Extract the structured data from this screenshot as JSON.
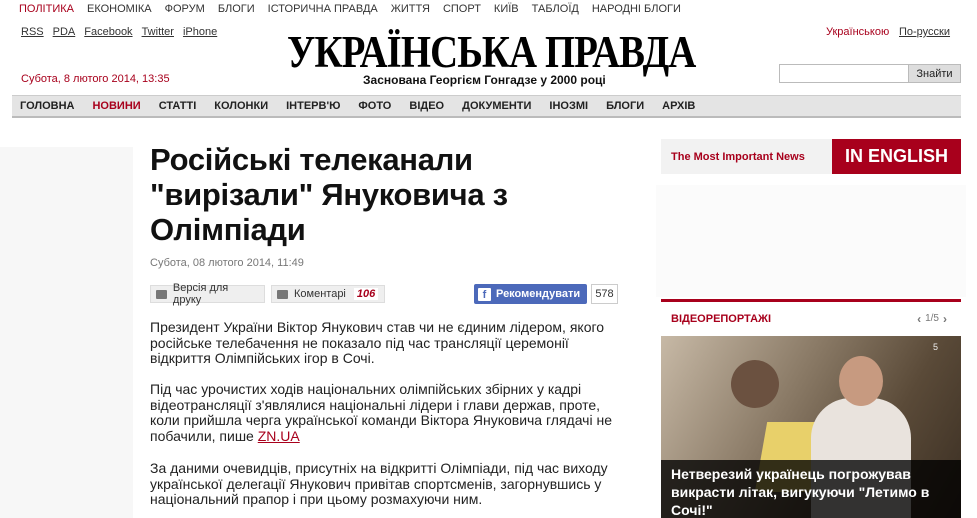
{
  "top_nav": [
    "ПОЛІТИКА",
    "ЕКОНОМІКА",
    "ФОРУМ",
    "БЛОГИ",
    "ІСТОРИЧНА ПРАВДА",
    "ЖИТТЯ",
    "СПОРТ",
    "КИЇВ",
    "ТАБЛОЇД",
    "НАРОДНІ БЛОГИ"
  ],
  "links": [
    "RSS",
    "PDA",
    "Facebook",
    "Twitter",
    "iPhone"
  ],
  "logo": "УКРАЇНСЬКА ПРАВДА",
  "tagline": "Заснована Георгієм Гонгадзе у 2000 році",
  "lang": {
    "ua": "Українською",
    "ru": "По-русски"
  },
  "date": "Субота, 8 лютого 2014, 13:35",
  "search": {
    "button": "Знайти",
    "placeholder": ""
  },
  "main_nav": [
    "ГОЛОВНА",
    "НОВИНИ",
    "СТАТТІ",
    "КОЛОНКИ",
    "ІНТЕРВ'Ю",
    "ФОТО",
    "ВІДЕО",
    "ДОКУМЕНТИ",
    "ІНОЗМІ",
    "БЛОГИ",
    "АРХІВ"
  ],
  "article": {
    "title": "Російські телеканали \"вирізали\" Януковича з Олімпіади",
    "date": "Субота, 08 лютого 2014, 11:49",
    "print_label": "Версія для друку",
    "comments_label": "Коментарі",
    "comments_count": "106",
    "fb_label": "Рекомендувати",
    "fb_count": "578",
    "p1": "Президент України Віктор Янукович став чи не єдиним лідером, якого російське телебачення не показало під час трансляції церемонії відкриття Олімпійських ігор в Сочі.",
    "p2_text": "Під час урочистих ходів національних олімпійських збірних у кадрі відеотрансляції з'являлися національні лідери і глави держав, проте, коли прийшла черга української команди Віктора Януковича глядачі не побачили, пише ",
    "p2_link": "ZN.UA",
    "p3": "За даними очевидців, присутніх на відкритті Олімпіади, під час виходу української делегації Янукович привітав спортсменів, загорнувшись у національний прапор і при цьому розмахуючи ним."
  },
  "sidebar": {
    "most_important": "The Most Important News",
    "in_english": "IN ENGLISH",
    "video_label": "ВІДЕОРЕПОРТАЖІ",
    "pager": "1/5",
    "video_logo": "5",
    "video_caption": "Нетверезий українець погрожував викрасти літак, вигукуючи \"Летимо в Сочі!\""
  },
  "colors": {
    "accent": "#a8001c",
    "facebook": "#4c69ba"
  }
}
